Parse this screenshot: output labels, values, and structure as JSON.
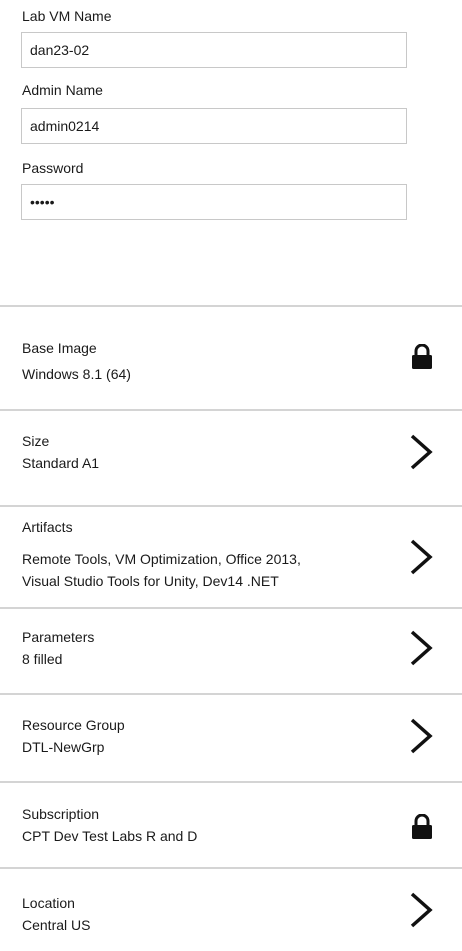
{
  "form": {
    "vm_name": {
      "label": "Lab VM Name",
      "value": "dan23-02"
    },
    "admin_name": {
      "label": "Admin Name",
      "value": "admin0214"
    },
    "password": {
      "label": "Password",
      "value": "•••••"
    }
  },
  "settings": [
    {
      "title": "Base Image",
      "value": "Windows 8.1 (64)",
      "icon": "lock-icon"
    },
    {
      "title": "Size",
      "value": "Standard A1",
      "icon": "chevron-right-icon"
    },
    {
      "title": "Artifacts",
      "value": "Remote Tools, VM Optimization, Office 2013,",
      "value2": "Visual Studio Tools for Unity, Dev14 .NET",
      "icon": "chevron-right-icon"
    },
    {
      "title": "Parameters",
      "value": "8 filled",
      "icon": "chevron-right-icon"
    },
    {
      "title": "Resource Group",
      "value": "DTL-NewGrp",
      "icon": "chevron-right-icon"
    },
    {
      "title": "Subscription",
      "value": "CPT Dev Test Labs R and D",
      "icon": "lock-icon"
    },
    {
      "title": "Location",
      "value": "Central US",
      "icon": "chevron-right-icon"
    }
  ]
}
